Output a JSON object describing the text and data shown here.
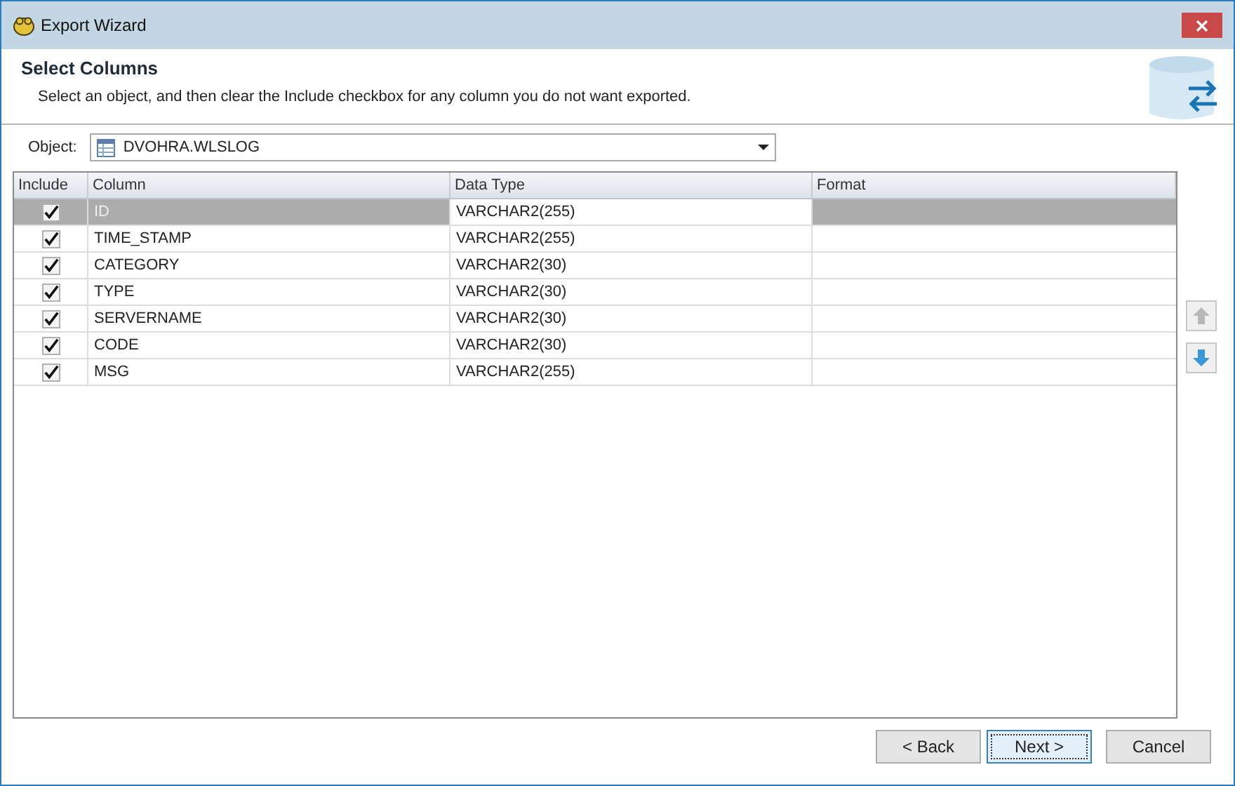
{
  "window": {
    "title": "Export Wizard"
  },
  "header": {
    "title": "Select Columns",
    "description": "Select an object, and then clear the Include checkbox for any column you do not want exported."
  },
  "object": {
    "label": "Object:",
    "value": "DVOHRA.WLSLOG"
  },
  "table": {
    "columns": [
      "Include",
      "Column",
      "Data Type",
      "Format"
    ],
    "rows": [
      {
        "include": true,
        "column": "ID",
        "data_type": "VARCHAR2(255)",
        "selected": true
      },
      {
        "include": true,
        "column": "TIME_STAMP",
        "data_type": "VARCHAR2(255)",
        "selected": false
      },
      {
        "include": true,
        "column": "CATEGORY",
        "data_type": "VARCHAR2(30)",
        "selected": false
      },
      {
        "include": true,
        "column": "TYPE",
        "data_type": "VARCHAR2(30)",
        "selected": false
      },
      {
        "include": true,
        "column": "SERVERNAME",
        "data_type": "VARCHAR2(30)",
        "selected": false
      },
      {
        "include": true,
        "column": "CODE",
        "data_type": "VARCHAR2(30)",
        "selected": false
      },
      {
        "include": true,
        "column": "MSG",
        "data_type": "VARCHAR2(255)",
        "selected": false
      }
    ]
  },
  "move_buttons": {
    "up_disabled": true,
    "down_disabled": false
  },
  "buttons": [
    {
      "label": "< Back",
      "focused": false
    },
    {
      "label": "Next >",
      "focused": true
    },
    {
      "label": "Cancel",
      "focused": false
    }
  ]
}
